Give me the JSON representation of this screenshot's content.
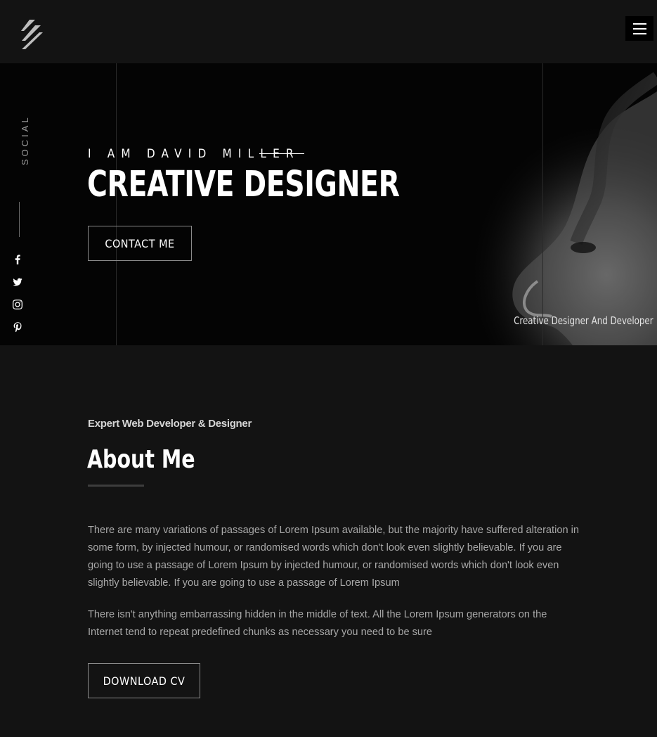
{
  "header": {
    "logo_icon": "stripes-logo-icon",
    "menu_icon": "hamburger-menu-icon"
  },
  "hero": {
    "pretitle": "I AM DAVID MILLER",
    "title": "CREATIVE DESIGNER",
    "contact_label": "CONTACT ME",
    "caption": "Creative Designer And Developer",
    "social_label": "SOCIAL",
    "social_icons": [
      "facebook-icon",
      "twitter-icon",
      "instagram-icon",
      "pinterest-icon"
    ]
  },
  "about": {
    "subtitle": "Expert Web Developer & Designer",
    "title": "About Me",
    "paragraph1": "There are many variations of passages of Lorem Ipsum available, but the majority have suffered alteration in some form, by injected humour, or randomised words which don't look even slightly believable. If you are going to use a passage of Lorem Ipsum by injected humour, or randomised words which don't look even slightly believable. If you are going to use a passage of Lorem Ipsum",
    "paragraph2": "There isn't anything embarrassing hidden in the middle of text. All the Lorem Ipsum generators on the Internet tend to repeat predefined chunks as necessary you need to be sure",
    "download_label": "DOWNLOAD CV"
  },
  "colors": {
    "background": "#131313",
    "hero_background": "#040404",
    "text_primary": "#ffffff",
    "text_muted": "#a8a8a8"
  }
}
